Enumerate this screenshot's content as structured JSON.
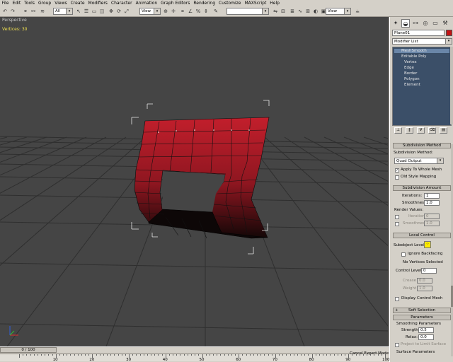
{
  "menu": [
    "File",
    "Edit",
    "Tools",
    "Group",
    "Views",
    "Create",
    "Modifiers",
    "Character",
    "Animation",
    "Graph Editors",
    "Rendering",
    "Customize",
    "MAXScript",
    "Help"
  ],
  "toolbar": {
    "selection_filter": "All",
    "ref_coord": "View",
    "named_selection": "",
    "render_view": "View"
  },
  "viewport": {
    "label": "Perspective",
    "stat": "Vertices: 30"
  },
  "panel": {
    "object_name": "Plane01",
    "object_color": "#c41414",
    "modifier_list": "Modifier List",
    "stack": [
      {
        "label": "MeshSmooth",
        "level": 0,
        "selected": true
      },
      {
        "label": "Editable Poly",
        "level": 0,
        "selected": false
      },
      {
        "label": "Vertex",
        "level": 1,
        "selected": false
      },
      {
        "label": "Edge",
        "level": 1,
        "selected": false
      },
      {
        "label": "Border",
        "level": 1,
        "selected": false
      },
      {
        "label": "Polygon",
        "level": 1,
        "selected": false
      },
      {
        "label": "Element",
        "level": 1,
        "selected": false
      }
    ],
    "subdivision_method": {
      "rollout": "Subdivision Method",
      "label": "Subdivision Method:",
      "value": "Quad Output",
      "apply_whole_mesh": "Apply To Whole Mesh",
      "apply_checked": true,
      "old_style": "Old Style Mapping",
      "old_style_checked": false
    },
    "subdivision_amount": {
      "rollout": "Subdivision Amount",
      "iterations_label": "Iterations:",
      "iterations": "1",
      "smoothness_label": "Smoothness:",
      "smoothness": "1.0",
      "render_values": "Render Values:",
      "r_iterations_label": "Iterations",
      "r_iterations": "0",
      "r_smoothness_label": "Smoothness",
      "r_smoothness": "1.0"
    },
    "local_control": {
      "rollout": "Local Control",
      "sublevel_label": "Subobject Level:",
      "ignore_backfacing": "Ignore Backfacing",
      "no_vertices": "No Vertices Selected",
      "control_level_label": "Control Level:",
      "control_level": "0",
      "crease_label": "Crease",
      "crease": "0.0",
      "weight_label": "Weight",
      "weight": "1.0",
      "display_control_mesh": "Display Control Mesh"
    },
    "soft_selection": "Soft Selection",
    "parameters": {
      "rollout": "Parameters",
      "smoothing_parameters": "Smoothing Parameters",
      "strength_label": "Strength:",
      "strength": "0.5",
      "relax_label": "Relax:",
      "relax": "0.0",
      "project_limit": "Project to Limit Surface",
      "surface_parameters": "Surface Parameters"
    }
  },
  "timeline": {
    "slider": "0 / 100",
    "ticks": [
      "10",
      "20",
      "30",
      "40",
      "50",
      "60",
      "70",
      "80",
      "90",
      "100"
    ],
    "cancel_mode": "Cancel Expert Mode"
  },
  "colors": {
    "viewport_bg": "#454545",
    "mesh_top": "#c21f2c",
    "mesh_bottom": "#1a0a0a",
    "grid_line": "#2e2e2e",
    "stack_bg": "#3b4f68",
    "highlight_yellow": "#ffea00"
  }
}
